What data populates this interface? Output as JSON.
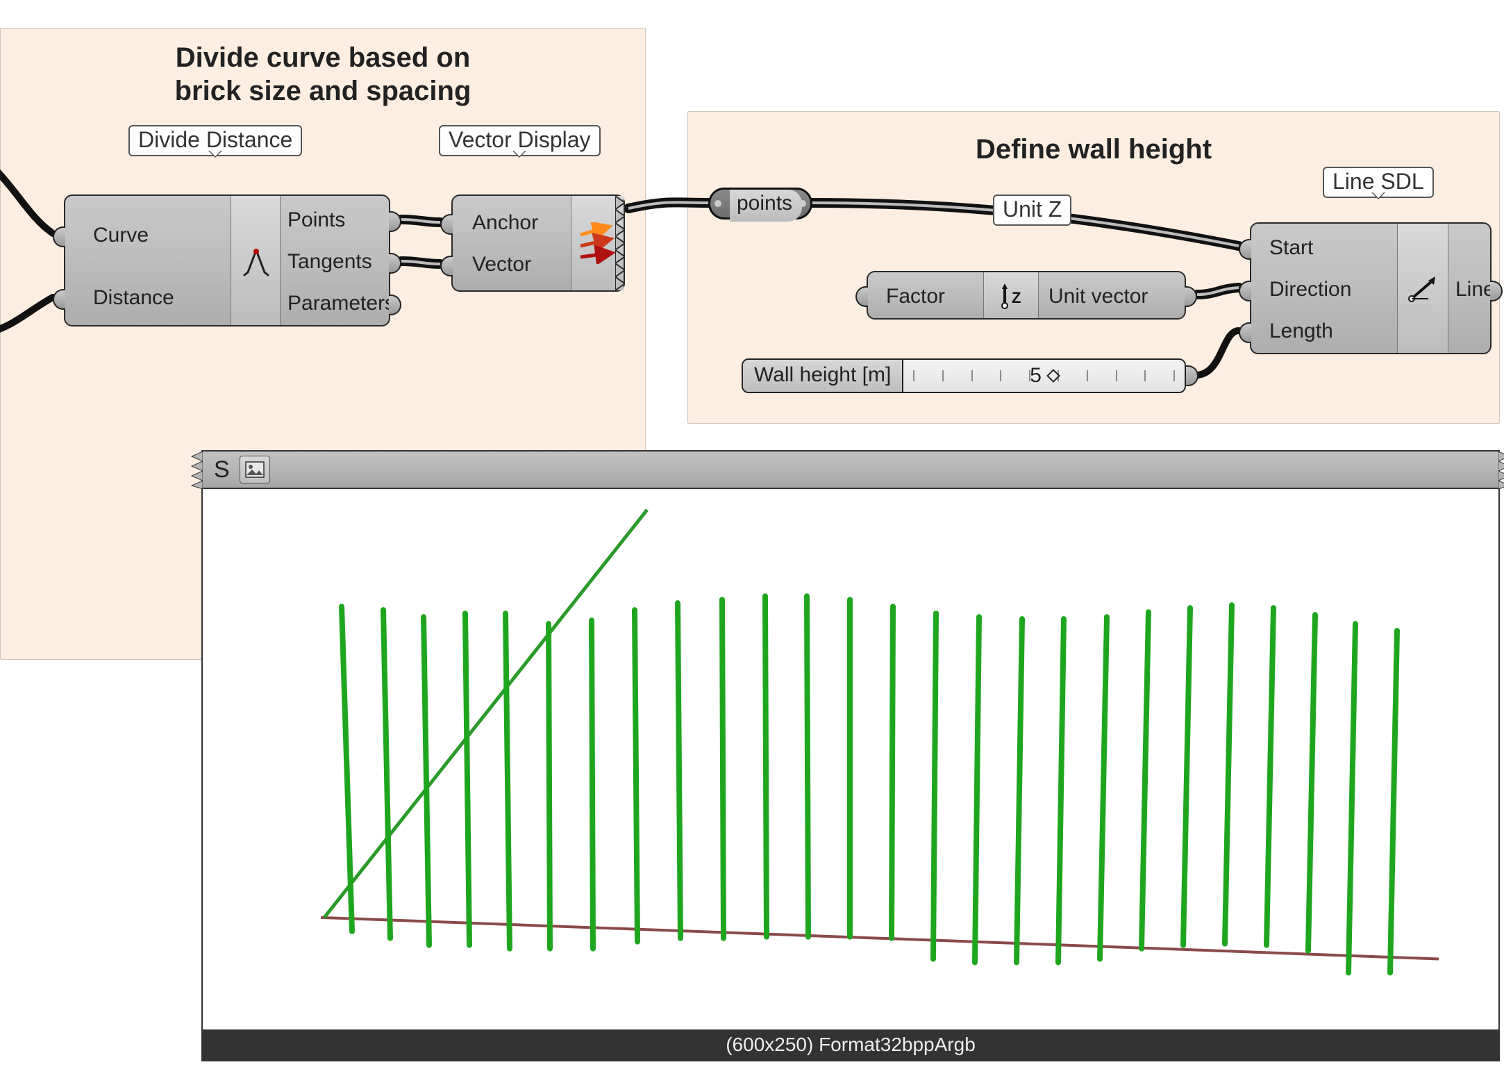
{
  "groups": {
    "divide": {
      "title_line1": "Divide curve based on",
      "title_line2": "brick size and spacing"
    },
    "height": {
      "title": "Define wall height"
    }
  },
  "tags": {
    "divide_distance": "Divide Distance",
    "vector_display": "Vector Display",
    "unit_z": "Unit Z",
    "line_sdl": "Line SDL"
  },
  "components": {
    "divide_distance": {
      "inputs": [
        "Curve",
        "Distance"
      ],
      "outputs": [
        "Points",
        "Tangents",
        "Parameters"
      ]
    },
    "vector_display": {
      "inputs": [
        "Anchor",
        "Vector"
      ]
    },
    "unit_z": {
      "inputs": [
        "Factor"
      ],
      "outputs": [
        "Unit vector"
      ]
    },
    "line_sdl": {
      "inputs": [
        "Start",
        "Direction",
        "Length"
      ],
      "outputs": [
        "Line"
      ]
    }
  },
  "relay": {
    "points": "points"
  },
  "slider": {
    "label": "Wall height [m]",
    "value": "5"
  },
  "viewport": {
    "header_char": "S",
    "footer": "(600x250) Format32bppArgb"
  },
  "colors": {
    "group_bg": "#fcefe2",
    "wire": "#1a1a1a",
    "line_green": "#1ea61e",
    "line_brown": "#8a4a4a",
    "arrow_orange": "#ff8a1a",
    "arrow_red": "#cc1a1a"
  }
}
